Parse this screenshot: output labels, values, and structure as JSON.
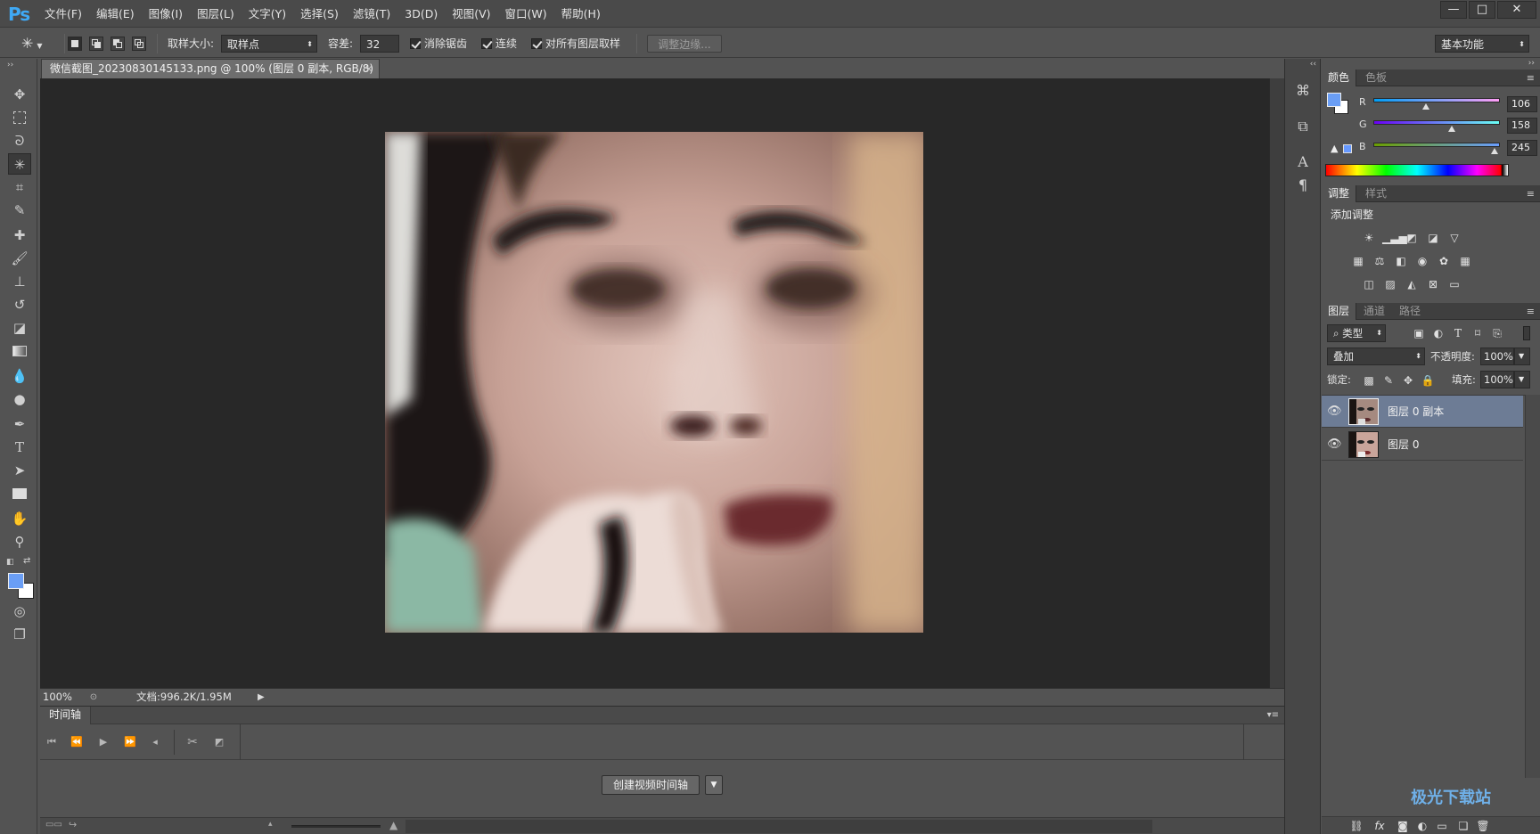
{
  "app": {
    "logo": "Ps"
  },
  "menu": [
    "文件(F)",
    "编辑(E)",
    "图像(I)",
    "图层(L)",
    "文字(Y)",
    "选择(S)",
    "滤镜(T)",
    "3D(D)",
    "视图(V)",
    "窗口(W)",
    "帮助(H)"
  ],
  "window_buttons": {
    "minimize": "—",
    "restore": "□",
    "close": "✕"
  },
  "options": {
    "sample_size_label": "取样大小:",
    "sample_size_value": "取样点",
    "tolerance_label": "容差:",
    "tolerance_value": "32",
    "antialias_label": "消除锯齿",
    "contiguous_label": "连续",
    "all_layers_label": "对所有图层取样",
    "refine_edge_label": "调整边缘...",
    "workspace_value": "基本功能"
  },
  "document": {
    "tab_title": "微信截图_20230830145133.png @ 100% (图层 0 副本, RGB/8) *",
    "close": "×"
  },
  "status": {
    "zoom": "100%",
    "doc_info": "文档:996.2K/1.95M"
  },
  "timeline": {
    "tab_label": "时间轴",
    "create_button": "创建视频时间轴"
  },
  "color_panel": {
    "tabs": [
      "颜色",
      "色板"
    ],
    "r_label": "R",
    "g_label": "G",
    "b_label": "B",
    "r_value": 106,
    "g_value": 158,
    "b_value": 245,
    "r_value_text": "106",
    "g_value_text": "158",
    "b_value_text": "245",
    "foreground_color": "#6a9ef5",
    "background_color": "#ffffff"
  },
  "adjust_panel": {
    "tabs": [
      "调整",
      "样式"
    ],
    "title": "添加调整"
  },
  "layers_panel": {
    "tabs": [
      "图层",
      "通道",
      "路径"
    ],
    "filter_type": "类型",
    "blend_mode": "叠加",
    "opacity_label": "不透明度:",
    "opacity_value": "100%",
    "lock_label": "锁定:",
    "fill_label": "填充:",
    "fill_value": "100%",
    "layers": [
      {
        "name": "图层 0 副本",
        "selected": true
      },
      {
        "name": "图层 0",
        "selected": false
      }
    ]
  },
  "watermark": "极光下载站"
}
